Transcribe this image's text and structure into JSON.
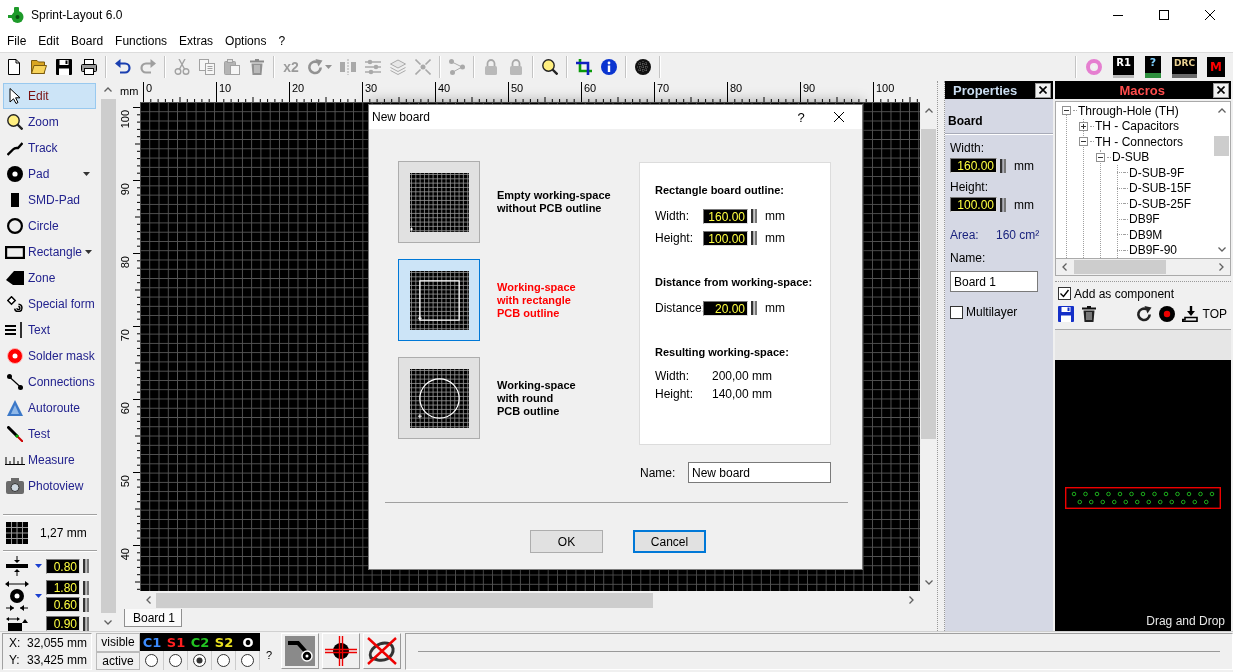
{
  "window": {
    "title": "Sprint-Layout 6.0"
  },
  "menu": [
    "File",
    "Edit",
    "Board",
    "Functions",
    "Extras",
    "Options",
    "?"
  ],
  "toolbar": {
    "groups": [
      [
        {
          "disabled": false,
          "dropdown": false
        },
        {
          "disabled": false,
          "dropdown": false
        },
        {
          "disabled": false,
          "dropdown": false
        },
        {
          "disabled": false,
          "dropdown": false
        }
      ],
      [
        {
          "disabled": false,
          "dropdown": false
        },
        {
          "disabled": true,
          "dropdown": false
        }
      ],
      [
        {
          "disabled": true,
          "dropdown": false
        },
        {
          "disabled": true,
          "dropdown": false
        },
        {
          "disabled": true,
          "dropdown": false
        },
        {
          "disabled": true,
          "dropdown": false
        }
      ],
      [
        {
          "label": "x2",
          "disabled": true,
          "dropdown": false
        },
        {
          "disabled": true,
          "dropdown": true
        },
        {
          "disabled": true,
          "dropdown": false
        },
        {
          "disabled": true,
          "dropdown": false
        },
        {
          "disabled": true,
          "dropdown": false
        },
        {
          "disabled": true,
          "dropdown": false
        }
      ],
      [
        {
          "disabled": true,
          "dropdown": false
        }
      ],
      [
        {
          "disabled": true,
          "dropdown": false
        },
        {
          "disabled": true,
          "dropdown": false
        }
      ],
      [
        {
          "disabled": false,
          "dropdown": false
        }
      ],
      [
        {
          "disabled": false,
          "dropdown": false
        },
        {
          "disabled": false,
          "dropdown": false
        }
      ],
      [
        {
          "disabled": false,
          "dropdown": false
        }
      ]
    ],
    "right": [
      {
        "disabled": false
      },
      {
        "label": "R1",
        "disabled": false
      },
      {
        "label": "?",
        "disabled": false
      },
      {
        "label": "DRC",
        "disabled": false
      },
      {
        "label": "M",
        "disabled": false
      }
    ]
  },
  "tools": [
    {
      "label": "Edit",
      "selected": true,
      "dropdown": false
    },
    {
      "label": "Zoom",
      "selected": false,
      "dropdown": false
    },
    {
      "label": "Track",
      "selected": false,
      "dropdown": false
    },
    {
      "label": "Pad",
      "selected": false,
      "dropdown": true
    },
    {
      "label": "SMD-Pad",
      "selected": false,
      "dropdown": false
    },
    {
      "label": "Circle",
      "selected": false,
      "dropdown": false
    },
    {
      "label": "Rectangle",
      "selected": false,
      "dropdown": true
    },
    {
      "label": "Zone",
      "selected": false,
      "dropdown": false
    },
    {
      "label": "Special form",
      "selected": false,
      "dropdown": false
    },
    {
      "label": "Text",
      "selected": false,
      "dropdown": false
    },
    {
      "label": "Solder mask",
      "selected": false,
      "dropdown": false
    },
    {
      "label": "Connections",
      "selected": false,
      "dropdown": false
    },
    {
      "label": "Autoroute",
      "selected": false,
      "dropdown": false
    },
    {
      "label": "Test",
      "selected": false,
      "dropdown": false
    },
    {
      "label": "Measure",
      "selected": false,
      "dropdown": false
    },
    {
      "label": "Photoview",
      "selected": false,
      "dropdown": false
    }
  ],
  "tool_settings": {
    "grid": {
      "value": "1,27 mm"
    },
    "rows": [
      {
        "kind": "track",
        "dropdown": true,
        "fields": [
          "0.80"
        ]
      },
      {
        "kind": "pad",
        "dropdown": true,
        "fields": [
          "1.80",
          "0.60"
        ]
      },
      {
        "kind": "smd",
        "fields": [
          "0.90"
        ]
      }
    ]
  },
  "canvas": {
    "ruler": {
      "unit": "mm",
      "x_labels": [
        "0",
        "10",
        "20",
        "30",
        "40",
        "50",
        "60",
        "70",
        "80",
        "90",
        "100"
      ],
      "y_labels": [
        "100",
        "90",
        "80",
        "70",
        "60",
        "50",
        "40"
      ]
    },
    "tabs": [
      {
        "label": "Board 1",
        "selected": true
      }
    ]
  },
  "properties": {
    "title": "Properties",
    "section": "Board",
    "fields": [
      {
        "label": "Width:",
        "value": "160.00",
        "unit": "mm"
      },
      {
        "label": "Height:",
        "value": "100.00",
        "unit": "mm"
      }
    ],
    "area": {
      "label": "Area:",
      "value": "160 cm²"
    },
    "name": {
      "label": "Name:",
      "value": "Board 1"
    },
    "multilayer": {
      "label": "Multilayer",
      "checked": false
    }
  },
  "macros": {
    "title": "Macros",
    "tree": [
      {
        "label": "Through-Hole (TH)",
        "expanded": true,
        "children": [
          {
            "label": "TH - Capacitors",
            "expanded": false
          },
          {
            "label": "TH - Connectors",
            "expanded": true,
            "children": [
              {
                "label": "D-SUB",
                "expanded": true,
                "children": [
                  {
                    "label": "D-SUB-9F"
                  },
                  {
                    "label": "D-SUB-15F"
                  },
                  {
                    "label": "D-SUB-25F"
                  },
                  {
                    "label": "DB9F"
                  },
                  {
                    "label": "DB9M"
                  },
                  {
                    "label": "DB9F-90"
                  }
                ]
              }
            ]
          }
        ]
      }
    ],
    "add_as_component": {
      "label": "Add as component",
      "checked": true
    },
    "side": "TOP",
    "preview_hint": "Drag and Drop"
  },
  "dialog": {
    "title": "New board",
    "help": "?",
    "options": [
      {
        "kind": "empty",
        "label": "Empty working-space\nwithout PCB outline",
        "selected": false
      },
      {
        "kind": "rectangle",
        "label": "Working-space\nwith rectangle\nPCB outline",
        "selected": true
      },
      {
        "kind": "round",
        "label": "Working-space\nwith round\nPCB outline",
        "selected": false
      }
    ],
    "sections": [
      {
        "heading": "Rectangle board outline:",
        "rows": [
          {
            "kind": "input",
            "label": "Width:",
            "value": "160.00",
            "unit": "mm"
          },
          {
            "kind": "input",
            "label": "Height:",
            "value": "100.00",
            "unit": "mm"
          }
        ]
      },
      {
        "heading": "Distance from working-space:",
        "rows": [
          {
            "kind": "input",
            "label": "Distance:",
            "value": "20.00",
            "unit": "mm"
          }
        ]
      },
      {
        "heading": "Resulting working-space:",
        "rows": [
          {
            "kind": "text",
            "label": "Width:",
            "value": "200,00 mm"
          },
          {
            "kind": "text",
            "label": "Height:",
            "value": "140,00 mm"
          }
        ]
      }
    ],
    "name": {
      "label": "Name:",
      "value": "New board"
    },
    "buttons": [
      {
        "label": "OK",
        "focused": false
      },
      {
        "label": "Cancel",
        "focused": true
      }
    ]
  },
  "status": {
    "coords": [
      {
        "label": "X:",
        "value": "32,055 mm"
      },
      {
        "label": "Y:",
        "value": "33,425 mm"
      }
    ],
    "layers": {
      "visible_label": "visible",
      "active_label": "active",
      "items": [
        {
          "label": "C1",
          "color": "#3c8cff",
          "selected": false
        },
        {
          "label": "S1",
          "color": "#ff2020",
          "selected": false
        },
        {
          "label": "C2",
          "color": "#22c422",
          "selected": true
        },
        {
          "label": "S2",
          "color": "#e8e020",
          "selected": false
        },
        {
          "label": "O",
          "color": "#ffffff",
          "selected": false
        }
      ],
      "help": "?"
    }
  }
}
